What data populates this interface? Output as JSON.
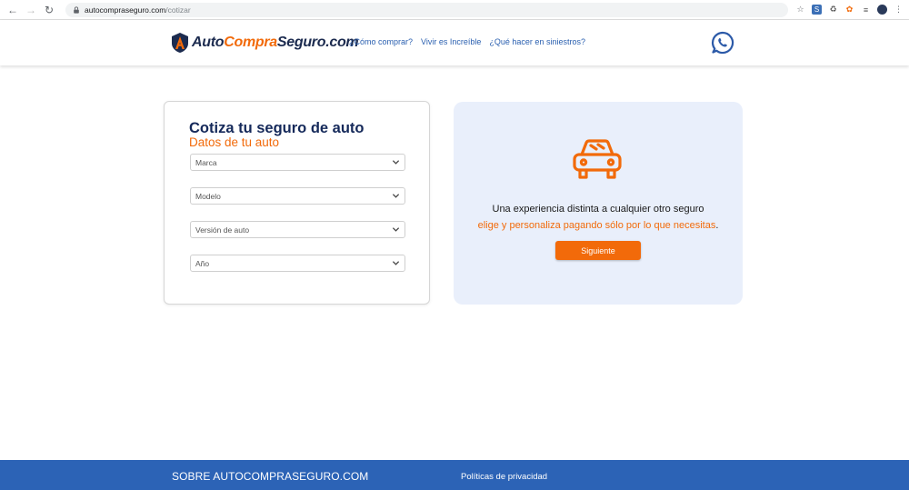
{
  "browser": {
    "url_host": "autocompraseguro.com",
    "url_path": "/cotizar"
  },
  "header": {
    "logo_part1": "Auto",
    "logo_part2": "Compra",
    "logo_part3": "Seguro.com",
    "nav": [
      "¿Cómo comprar?",
      "Vivir es Increíble",
      "¿Qué hacer en siniestros?"
    ]
  },
  "form": {
    "title": "Cotiza tu seguro de auto",
    "subtitle": "Datos de tu auto",
    "selects": [
      "Marca",
      "Modelo",
      "Versión de auto",
      "Año"
    ]
  },
  "promo": {
    "line1": "Una experiencia distinta a cualquier otro seguro",
    "line2": "elige y personaliza pagando sólo por lo que necesitas",
    "line2_end": ".",
    "button": "Siguiente"
  },
  "footer": {
    "about": "SOBRE AUTOCOMPRASEGURO.COM",
    "privacy": "Políticas de privacidad"
  },
  "colors": {
    "brand_navy": "#15295a",
    "brand_orange": "#f26a0a",
    "footer_blue": "#2c63b6",
    "promo_bg": "#e9effb"
  }
}
